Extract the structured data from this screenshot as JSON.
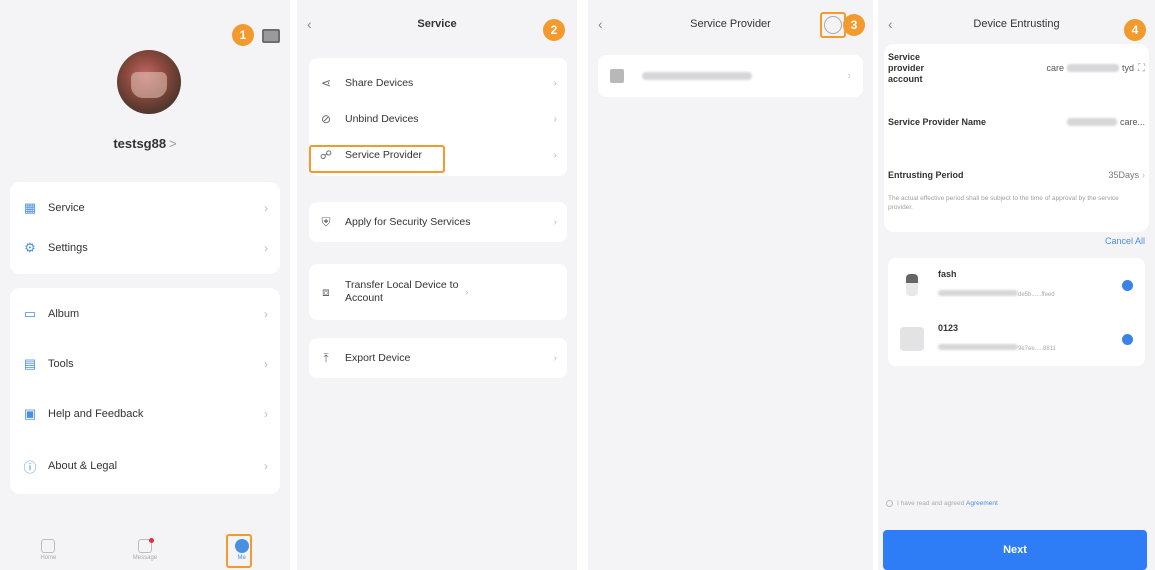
{
  "colors": {
    "accent": "#f29a2e",
    "primary": "#2e7cf6",
    "link": "#4a90e2"
  },
  "me": {
    "step": "1",
    "username": "testsg88",
    "username_chev": ">",
    "group1": [
      {
        "label": "Service",
        "icon": "service-icon"
      },
      {
        "label": "Settings",
        "icon": "settings-icon"
      }
    ],
    "group2": [
      {
        "label": "Album",
        "icon": "album-icon"
      },
      {
        "label": "Tools",
        "icon": "tools-icon"
      },
      {
        "label": "Help and Feedback",
        "icon": "help-icon"
      },
      {
        "label": "About & Legal",
        "icon": "about-icon"
      }
    ],
    "tabs": [
      {
        "label": "Home",
        "icon": "home-icon"
      },
      {
        "label": "Message",
        "icon": "message-icon"
      },
      {
        "label": "Me",
        "icon": "me-icon"
      }
    ]
  },
  "service": {
    "step": "2",
    "title": "Service",
    "rows": [
      {
        "label": "Share Devices",
        "icon": "share-icon"
      },
      {
        "label": "Unbind Devices",
        "icon": "unbind-icon"
      },
      {
        "label": "Service Provider",
        "icon": "service-provider-icon"
      },
      {
        "label": "Apply for Security Services",
        "icon": "security-icon"
      },
      {
        "label": "Transfer Local Device to Account",
        "icon": "transfer-icon"
      },
      {
        "label": "Export Device",
        "icon": "export-icon"
      }
    ]
  },
  "provider": {
    "step": "3",
    "title": "Service Provider"
  },
  "entrusting": {
    "step": "4",
    "title": "Device Entrusting",
    "account_label": "Service provider account",
    "account_value": "care",
    "account_suffix": "tyd",
    "name_label": "Service Provider Name",
    "name_value": "care...",
    "period_label": "Entrusting Period",
    "period_value": "35Days",
    "period_note": "The actual effective period shall be subject to the time of approval by the service provider.",
    "cancel_all": "Cancel All",
    "devices": [
      {
        "name": "fash",
        "id": "de5b......ffeed"
      },
      {
        "name": "0123",
        "id": "9e7ee.....8811"
      }
    ],
    "agree_prefix": "I have read and agreed",
    "agree_link": "Agreement",
    "next": "Next"
  }
}
